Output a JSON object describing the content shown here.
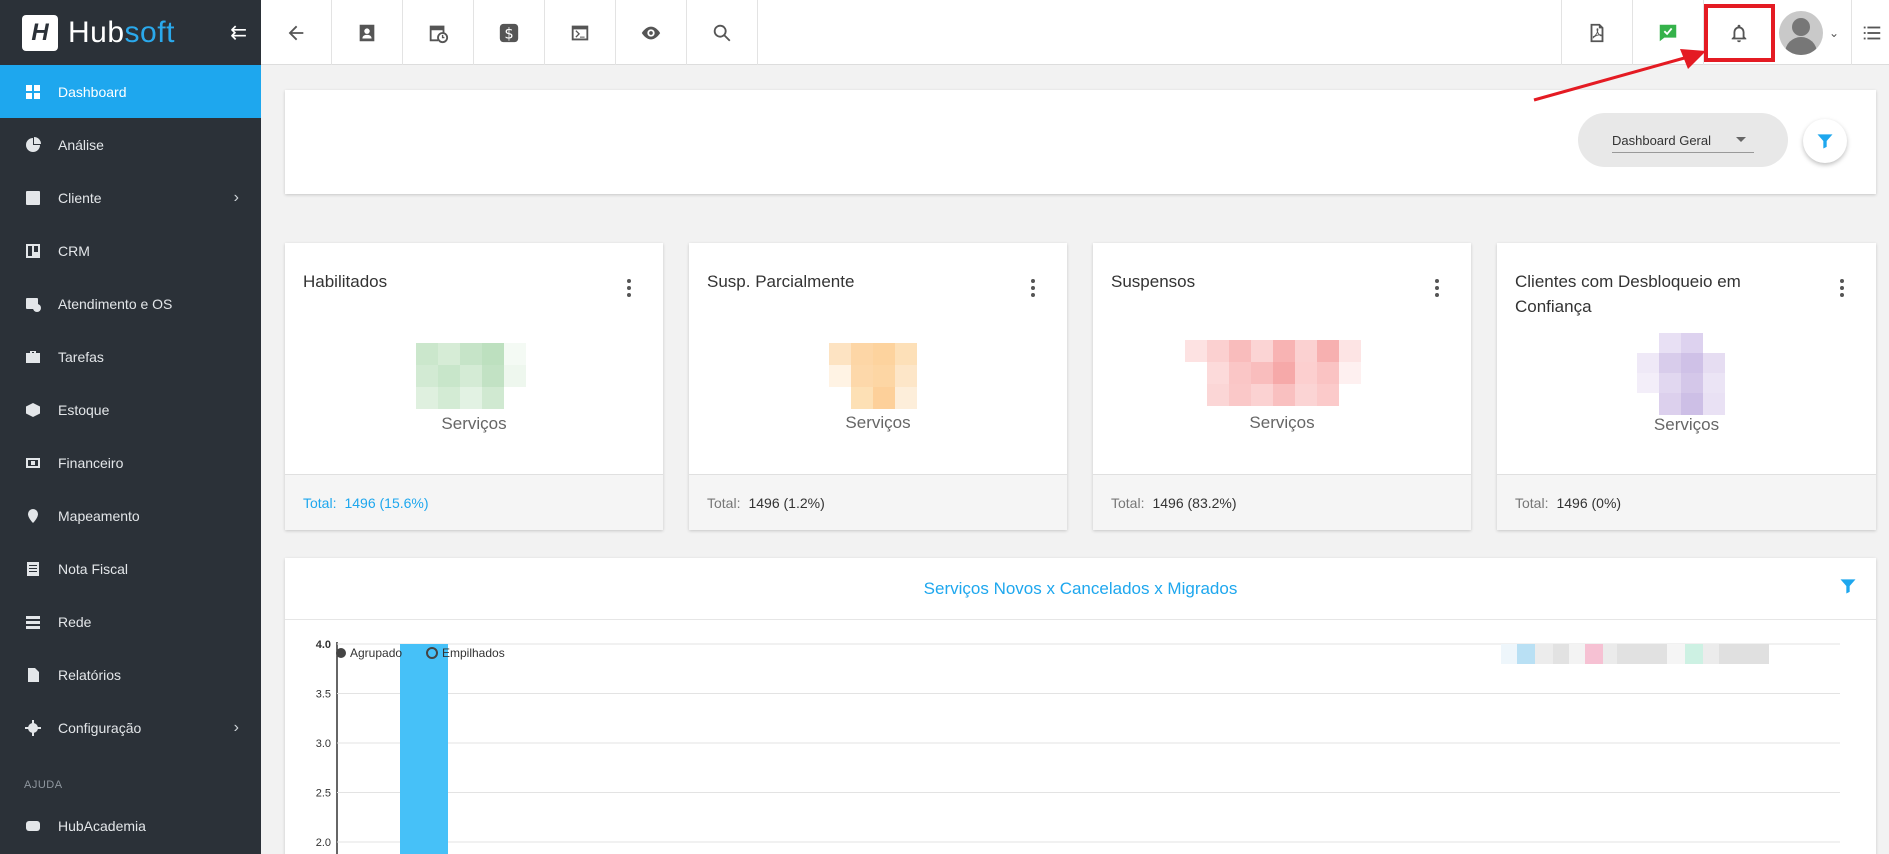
{
  "brand": {
    "mark": "H",
    "name_hub": "Hub",
    "name_soft": "soft"
  },
  "sidebar": {
    "items": [
      {
        "label": "Dashboard",
        "icon": "dashboard-icon"
      },
      {
        "label": "Análise",
        "icon": "pie-chart-icon"
      },
      {
        "label": "Cliente",
        "icon": "contact-card-icon"
      },
      {
        "label": "CRM",
        "icon": "board-icon"
      },
      {
        "label": "Atendimento e OS",
        "icon": "calendar-clock-icon"
      },
      {
        "label": "Tarefas",
        "icon": "briefcase-icon"
      },
      {
        "label": "Estoque",
        "icon": "box-icon"
      },
      {
        "label": "Financeiro",
        "icon": "money-icon"
      },
      {
        "label": "Mapeamento",
        "icon": "map-pin-icon"
      },
      {
        "label": "Nota Fiscal",
        "icon": "receipt-icon"
      },
      {
        "label": "Rede",
        "icon": "server-icon"
      },
      {
        "label": "Relatórios",
        "icon": "file-icon"
      },
      {
        "label": "Configuração",
        "icon": "gear-icon"
      }
    ],
    "section_help": "AJUDA",
    "help_item": {
      "label": "HubAcademia",
      "icon": "youtube-icon"
    }
  },
  "topbar": {
    "highlight_color": "#e41b23"
  },
  "dashboard_select": {
    "value": "Dashboard Geral"
  },
  "cards": [
    {
      "title": "Habilitados",
      "subtitle": "Serviços",
      "total_label": "Total:",
      "total_value": "1496 (15.6%)"
    },
    {
      "title": "Susp. Parcialmente",
      "subtitle": "Serviços",
      "total_label": "Total:",
      "total_value": "1496 (1.2%)"
    },
    {
      "title": "Suspensos",
      "subtitle": "Serviços",
      "total_label": "Total:",
      "total_value": "1496 (83.2%)"
    },
    {
      "title": "Clientes com Desbloqueio em Confiança",
      "subtitle": "Serviços",
      "total_label": "Total:",
      "total_value": "1496 (0%)"
    }
  ],
  "chart": {
    "title": "Serviços Novos x Cancelados x Migrados",
    "toggle": {
      "grouped": "Agrupado",
      "stacked": "Empilhados"
    }
  },
  "chart_data": {
    "type": "bar",
    "title": "Serviços Novos x Cancelados x Migrados",
    "yticks": [
      "4.0",
      "3.5",
      "3.0",
      "2.5",
      "2.0"
    ],
    "ylim": [
      2.0,
      4.0
    ],
    "series": [
      {
        "values": [
          4.0
        ]
      }
    ],
    "grid": true,
    "accent": "#46c1f8"
  },
  "colors": {
    "accent": "#1ea7ee",
    "sidebar_bg": "#2b3138"
  }
}
